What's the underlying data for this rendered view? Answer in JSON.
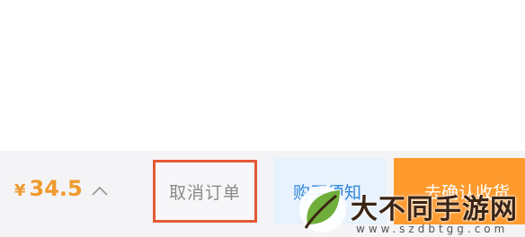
{
  "order_bar": {
    "currency_symbol": "¥",
    "price": "34.5",
    "cancel_label": "取消订单",
    "buy_again_label": "购买须知",
    "confirm_label": "去确认收货"
  },
  "watermark": {
    "title": "大不同手游网",
    "url": "www.szdbtgg.com"
  },
  "colors": {
    "price": "#ef9a2e",
    "highlight_border": "#e45a36",
    "confirm_bg": "#ff9a2e",
    "buy_again_bg": "#e8f2fc",
    "buy_again_text": "#2f86db"
  },
  "icons": {
    "expand": "chevron-up-icon",
    "watermark_logo": "leaf-logo-icon"
  }
}
